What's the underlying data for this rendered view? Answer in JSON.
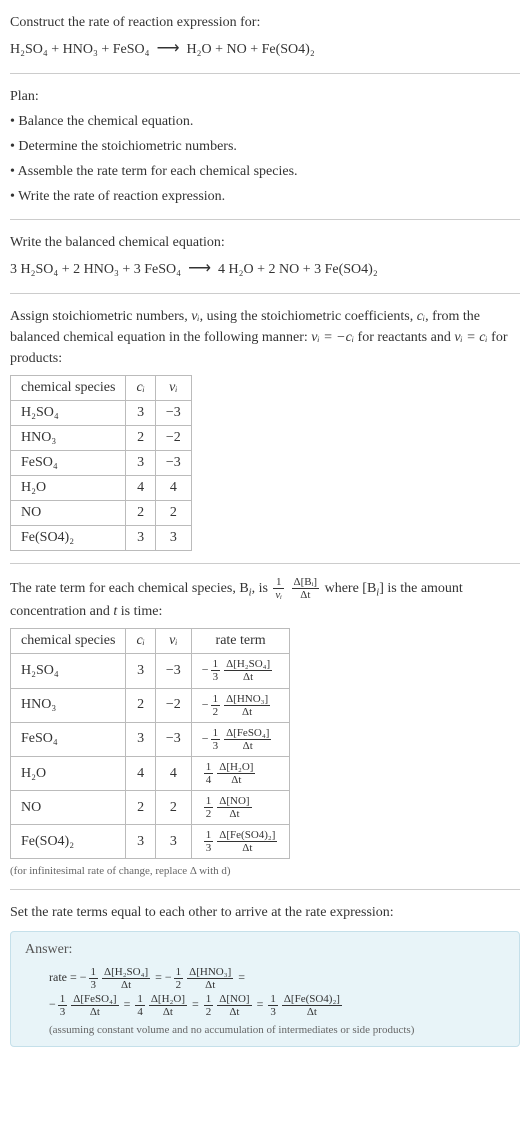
{
  "intro": "Construct the rate of reaction expression for:",
  "eq_unbalanced_lhs": "H₂SO₄ + HNO₃ + FeSO₄",
  "arrow": "⟶",
  "eq_unbalanced_rhs": "H₂O + NO + Fe(SO4)₂",
  "plan_title": "Plan:",
  "plan": [
    "Balance the chemical equation.",
    "Determine the stoichiometric numbers.",
    "Assemble the rate term for each chemical species.",
    "Write the rate of reaction expression."
  ],
  "balanced_title": "Write the balanced chemical equation:",
  "eq_balanced_lhs": "3 H₂SO₄ + 2 HNO₃ + 3 FeSO₄",
  "eq_balanced_rhs": "4 H₂O + 2 NO + 3 Fe(SO4)₂",
  "assign_text_a": "Assign stoichiometric numbers, ",
  "nu_i": "νᵢ",
  "assign_text_b": ", using the stoichiometric coefficients, ",
  "c_i": "cᵢ",
  "assign_text_c": ", from the balanced chemical equation in the following manner: ",
  "rel1": "νᵢ = −cᵢ",
  "assign_text_d": " for reactants and ",
  "rel2": "νᵢ = cᵢ",
  "assign_text_e": " for products:",
  "hdr_species": "chemical species",
  "hdr_ci": "cᵢ",
  "hdr_nui": "νᵢ",
  "hdr_rate": "rate term",
  "species": [
    {
      "name": "H₂SO₄",
      "c": "3",
      "nu": "−3"
    },
    {
      "name": "HNO₃",
      "c": "2",
      "nu": "−2"
    },
    {
      "name": "FeSO₄",
      "c": "3",
      "nu": "−3"
    },
    {
      "name": "H₂O",
      "c": "4",
      "nu": "4"
    },
    {
      "name": "NO",
      "c": "2",
      "nu": "2"
    },
    {
      "name": "Fe(SO4)₂",
      "c": "3",
      "nu": "3"
    }
  ],
  "rate_intro_a": "The rate term for each chemical species, B",
  "rate_intro_b": ", is ",
  "rate_intro_c": " where [B",
  "rate_intro_d": "] is the amount concentration and ",
  "rate_intro_e": " is time:",
  "t_label": "t",
  "i_label": "i",
  "one_label": "1",
  "delta_bi": "Δ[Bᵢ]",
  "delta_t": "Δt",
  "rate_terms": [
    {
      "sign": "−",
      "coef": "3",
      "num": "Δ[H₂SO₄]"
    },
    {
      "sign": "−",
      "coef": "2",
      "num": "Δ[HNO₃]"
    },
    {
      "sign": "−",
      "coef": "3",
      "num": "Δ[FeSO₄]"
    },
    {
      "sign": "",
      "coef": "4",
      "num": "Δ[H₂O]"
    },
    {
      "sign": "",
      "coef": "2",
      "num": "Δ[NO]"
    },
    {
      "sign": "",
      "coef": "3",
      "num": "Δ[Fe(SO4)₂]"
    }
  ],
  "foot1": "(for infinitesimal rate of change, replace Δ with d)",
  "set_equal": "Set the rate terms equal to each other to arrive at the rate expression:",
  "answer_label": "Answer:",
  "rate_eq_lead": "rate = ",
  "eq": " = ",
  "answer_foot": "(assuming constant volume and no accumulation of intermediates or side products)"
}
